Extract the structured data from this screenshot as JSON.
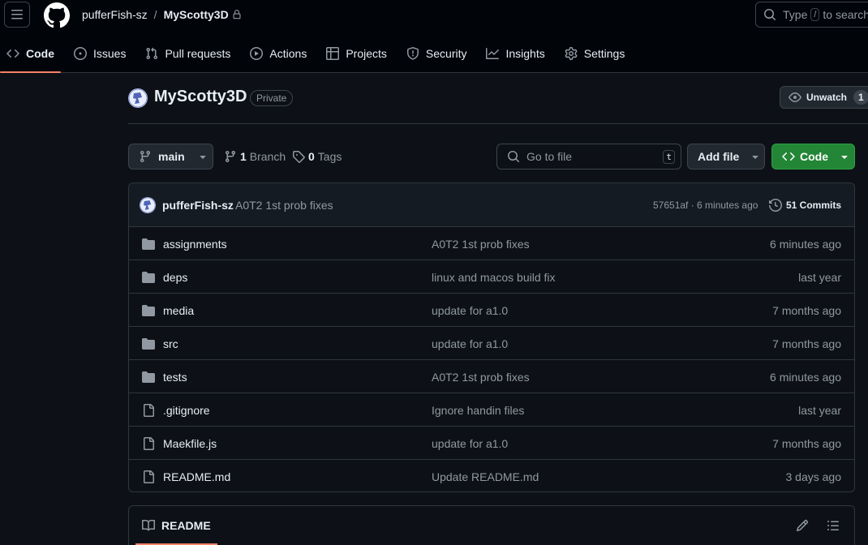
{
  "header": {
    "owner": "pufferFish-sz",
    "separator": "/",
    "repo": "MyScotty3D",
    "search": {
      "prefix": "Type",
      "key": "/",
      "suffix": "to search"
    }
  },
  "tabs": [
    {
      "label": "Code",
      "icon": "code-icon",
      "active": true
    },
    {
      "label": "Issues",
      "icon": "issue-opened-icon"
    },
    {
      "label": "Pull requests",
      "icon": "git-pull-request-icon"
    },
    {
      "label": "Actions",
      "icon": "play-icon"
    },
    {
      "label": "Projects",
      "icon": "table-icon"
    },
    {
      "label": "Security",
      "icon": "shield-icon"
    },
    {
      "label": "Insights",
      "icon": "graph-icon"
    },
    {
      "label": "Settings",
      "icon": "gear-icon"
    }
  ],
  "repo_header": {
    "title": "MyScotty3D",
    "visibility": "Private",
    "watch_label": "Unwatch",
    "watch_count": "1"
  },
  "file_nav": {
    "branch": "main",
    "branch_count": "1",
    "branch_label": "Branch",
    "tag_count": "0",
    "tag_label": "Tags",
    "goto_placeholder": "Go to file",
    "goto_key": "t",
    "add_file_label": "Add file",
    "code_label": "Code"
  },
  "latest_commit": {
    "author": "pufferFish-sz",
    "message": "A0T2 1st prob fixes",
    "hash_time": "57651af · 6 minutes ago",
    "commits_label": "51 Commits"
  },
  "files": [
    {
      "type": "dir",
      "name": "assignments",
      "message": "A0T2 1st prob fixes",
      "date": "6 minutes ago"
    },
    {
      "type": "dir",
      "name": "deps",
      "message": "linux and macos build fix",
      "date": "last year"
    },
    {
      "type": "dir",
      "name": "media",
      "message": "update for a1.0",
      "date": "7 months ago"
    },
    {
      "type": "dir",
      "name": "src",
      "message": "update for a1.0",
      "date": "7 months ago"
    },
    {
      "type": "dir",
      "name": "tests",
      "message": "A0T2 1st prob fixes",
      "date": "6 minutes ago"
    },
    {
      "type": "file",
      "name": ".gitignore",
      "message": "Ignore handin files",
      "date": "last year"
    },
    {
      "type": "file",
      "name": "Maekfile.js",
      "message": "update for a1.0",
      "date": "7 months ago"
    },
    {
      "type": "file",
      "name": "README.md",
      "message": "Update README.md",
      "date": "3 days ago"
    }
  ],
  "readme": {
    "tab_label": "README"
  },
  "colors": {
    "background": "#0d1117",
    "header_bg": "#010409",
    "accent_underline": "#f78166",
    "code_button": "#238636",
    "folder_icon": "#9198a1"
  }
}
